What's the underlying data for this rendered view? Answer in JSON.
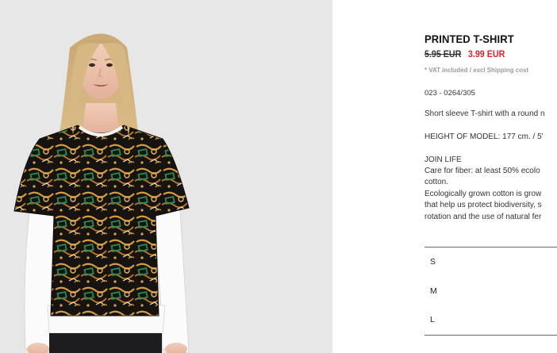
{
  "product": {
    "title": "PRINTED T-SHIRT",
    "old_price": "5.95 EUR",
    "new_price": "3.99 EUR",
    "vat_note": "* VAT included / excl Shipping cost",
    "reference": "023 - 0264/305",
    "description": "Short sleeve T-shirt with a round n",
    "model_height": "HEIGHT OF MODEL: 177 cm. / 5'",
    "join_life": {
      "heading": "JOIN LIFE",
      "lines": [
        "Care for fiber: at least 50% ecolo",
        "cotton.",
        "Ecologically grown cotton is grow",
        "that help us protect biodiversity, s",
        "rotation and the use of natural fer"
      ]
    },
    "sizes": [
      "S",
      "M",
      "L"
    ],
    "colors": {
      "price_sale": "#e41f2b",
      "vat_gray": "#9a9a9a",
      "photo_bg": "#e7e7e7"
    }
  }
}
